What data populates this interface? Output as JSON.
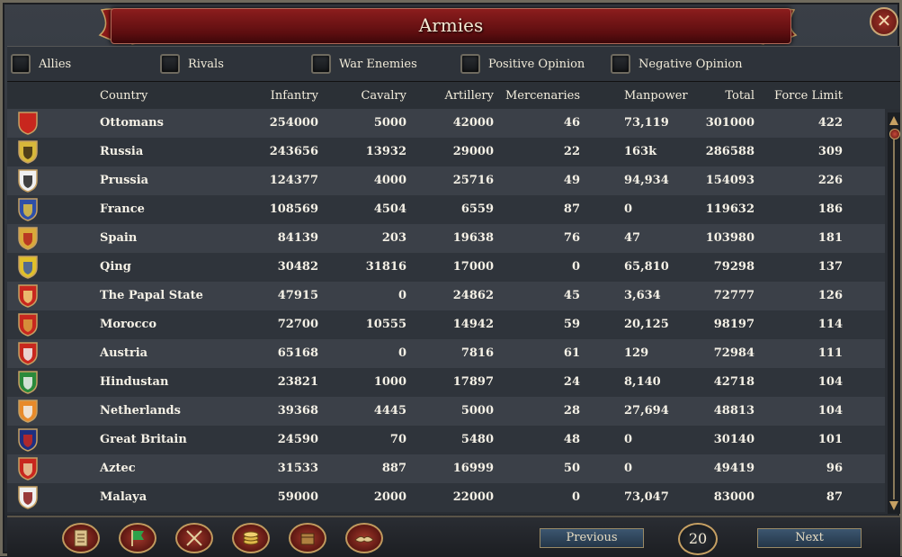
{
  "window": {
    "title": "Armies",
    "close_symbol": "✕"
  },
  "filters": [
    {
      "label": "Allies"
    },
    {
      "label": "Rivals"
    },
    {
      "label": "War Enemies"
    },
    {
      "label": "Positive Opinion"
    },
    {
      "label": "Negative Opinion"
    }
  ],
  "table": {
    "headers": {
      "country": "Country",
      "infantry": "Infantry",
      "cavalry": "Cavalry",
      "artillery": "Artillery",
      "mercenaries": "Mercenaries",
      "manpower": "Manpower",
      "total": "Total",
      "force_limit": "Force Limit"
    },
    "rows": [
      {
        "country": "Ottomans",
        "infantry": "254000",
        "cavalry": "5000",
        "artillery": "42000",
        "mercenaries": "46",
        "manpower": "73,119",
        "total": "301000",
        "force_limit": "422",
        "colors": [
          "#c8271e",
          "#c8271e"
        ]
      },
      {
        "country": "Russia",
        "infantry": "243656",
        "cavalry": "13932",
        "artillery": "29000",
        "mercenaries": "22",
        "manpower": "163k",
        "total": "286588",
        "force_limit": "309",
        "colors": [
          "#d8b83a",
          "#3a2a14"
        ]
      },
      {
        "country": "Prussia",
        "infantry": "124377",
        "cavalry": "4000",
        "artillery": "25716",
        "mercenaries": "49",
        "manpower": "94,934",
        "total": "154093",
        "force_limit": "226",
        "colors": [
          "#f0f0f0",
          "#222222"
        ]
      },
      {
        "country": "France",
        "infantry": "108569",
        "cavalry": "4504",
        "artillery": "6559",
        "mercenaries": "87",
        "manpower": "0",
        "total": "119632",
        "force_limit": "186",
        "colors": [
          "#2e4fa8",
          "#e0c040"
        ]
      },
      {
        "country": "Spain",
        "infantry": "84139",
        "cavalry": "203",
        "artillery": "19638",
        "mercenaries": "76",
        "manpower": "47",
        "total": "103980",
        "force_limit": "181",
        "colors": [
          "#d9a93a",
          "#b3261e"
        ]
      },
      {
        "country": "Qing",
        "infantry": "30482",
        "cavalry": "31816",
        "artillery": "17000",
        "mercenaries": "0",
        "manpower": "65,810",
        "total": "79298",
        "force_limit": "137",
        "colors": [
          "#e0c02a",
          "#3a5aa0"
        ]
      },
      {
        "country": "The Papal State",
        "infantry": "47915",
        "cavalry": "0",
        "artillery": "24862",
        "mercenaries": "45",
        "manpower": "3,634",
        "total": "72777",
        "force_limit": "126",
        "colors": [
          "#c8271e",
          "#f0d27a"
        ]
      },
      {
        "country": "Morocco",
        "infantry": "72700",
        "cavalry": "10555",
        "artillery": "14942",
        "mercenaries": "59",
        "manpower": "20,125",
        "total": "98197",
        "force_limit": "114",
        "colors": [
          "#c8271e",
          "#d8a040"
        ]
      },
      {
        "country": "Austria",
        "infantry": "65168",
        "cavalry": "0",
        "artillery": "7816",
        "mercenaries": "61",
        "manpower": "129",
        "total": "72984",
        "force_limit": "111",
        "colors": [
          "#c8271e",
          "#f0f0f0"
        ]
      },
      {
        "country": "Hindustan",
        "infantry": "23821",
        "cavalry": "1000",
        "artillery": "17897",
        "mercenaries": "24",
        "manpower": "8,140",
        "total": "42718",
        "force_limit": "104",
        "colors": [
          "#2a8a3a",
          "#f0f0f0"
        ]
      },
      {
        "country": "Netherlands",
        "infantry": "39368",
        "cavalry": "4445",
        "artillery": "5000",
        "mercenaries": "28",
        "manpower": "27,694",
        "total": "48813",
        "force_limit": "104",
        "colors": [
          "#e88a2a",
          "#f0f0f0"
        ]
      },
      {
        "country": "Great Britain",
        "infantry": "24590",
        "cavalry": "70",
        "artillery": "5480",
        "mercenaries": "48",
        "manpower": "0",
        "total": "30140",
        "force_limit": "101",
        "colors": [
          "#1e2f80",
          "#c8271e"
        ]
      },
      {
        "country": "Aztec",
        "infantry": "31533",
        "cavalry": "887",
        "artillery": "16999",
        "mercenaries": "50",
        "manpower": "0",
        "total": "49419",
        "force_limit": "96",
        "colors": [
          "#c8271e",
          "#e8d0a0"
        ]
      },
      {
        "country": "Malaya",
        "infantry": "59000",
        "cavalry": "2000",
        "artillery": "22000",
        "mercenaries": "0",
        "manpower": "73,047",
        "total": "83000",
        "force_limit": "87",
        "colors": [
          "#f0f0f0",
          "#8a1a1a"
        ]
      }
    ]
  },
  "footer": {
    "tab_icons": [
      "ledger-icon",
      "flag-icon",
      "crossed-swords-icon",
      "coins-icon",
      "trade-goods-icon",
      "diplomacy-icon"
    ],
    "previous_label": "Previous",
    "next_label": "Next",
    "page": "20"
  },
  "colors": {
    "title_red": "#8c1d1d",
    "gold_trim": "#c6a063",
    "row_odd": "#3b4048",
    "row_even": "#2f343b"
  }
}
